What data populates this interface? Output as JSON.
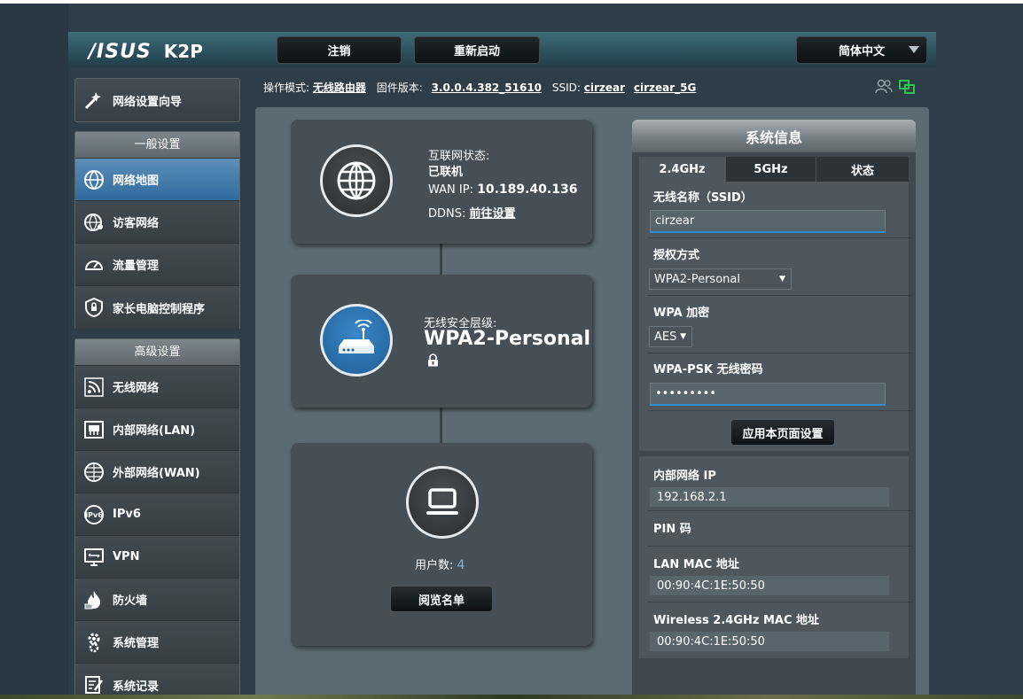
{
  "header": {
    "brand": "/ISUS",
    "model": "K2P",
    "logout_label": "注销",
    "reboot_label": "重新启动",
    "language": "简体中文"
  },
  "infobar": {
    "mode_label": "操作模式:",
    "mode_value": "无线路由器",
    "firmware_label": "固件版本:",
    "firmware_value": "3.0.0.4.382_51610",
    "ssid_label": "SSID:",
    "ssid_24": "cirzear",
    "ssid_5": "cirzear_5G"
  },
  "sidebar": {
    "quick_setup": "网络设置向导",
    "general_title": "一般设置",
    "general_items": [
      {
        "label": "网络地图",
        "icon": "network-map-icon",
        "active": true
      },
      {
        "label": "访客网络",
        "icon": "guest-network-icon",
        "active": false
      },
      {
        "label": "流量管理",
        "icon": "traffic-gauge-icon",
        "active": false
      },
      {
        "label": "家长电脑控制程序",
        "icon": "parental-lock-icon",
        "active": false
      }
    ],
    "advanced_title": "高级设置",
    "advanced_items": [
      {
        "label": "无线网络",
        "icon": "wireless-icon"
      },
      {
        "label": "内部网络(LAN)",
        "icon": "lan-icon"
      },
      {
        "label": "外部网络(WAN)",
        "icon": "wan-globe-icon"
      },
      {
        "label": "IPv6",
        "icon": "ipv6-icon"
      },
      {
        "label": "VPN",
        "icon": "vpn-icon"
      },
      {
        "label": "防火墙",
        "icon": "firewall-icon"
      },
      {
        "label": "系统管理",
        "icon": "admin-gear-icon"
      },
      {
        "label": "系统记录",
        "icon": "system-log-icon"
      }
    ]
  },
  "network_map": {
    "internet_status_label": "互联网状态:",
    "internet_status_value": "已联机",
    "wan_ip_label": "WAN IP:",
    "wan_ip_value": "10.189.40.136",
    "ddns_label": "DDNS:",
    "ddns_value": "前往设置",
    "security_label": "无线安全层级:",
    "security_value": "WPA2-Personal",
    "clients_label": "用户数:",
    "clients_count": "4",
    "view_list_button": "阅览名单"
  },
  "system_info": {
    "title": "系统信息",
    "tabs": [
      "2.4GHz",
      "5GHz",
      "状态"
    ],
    "active_tab": "2.4GHz",
    "ssid_label": "无线名称（SSID）",
    "ssid_value": "cirzear",
    "auth_label": "授权方式",
    "auth_value": "WPA2-Personal",
    "wpa_enc_label": "WPA 加密",
    "wpa_enc_value": "AES",
    "psk_label": "WPA-PSK 无线密码",
    "psk_value": "•••••••••",
    "apply_button": "应用本页面设置",
    "lan_ip_label": "内部网络 IP",
    "lan_ip_value": "192.168.2.1",
    "pin_label": "PIN 码",
    "lan_mac_label": "LAN MAC 地址",
    "lan_mac_value": "00:90:4C:1E:50:50",
    "wl_mac_label": "Wireless 2.4GHz MAC 地址",
    "wl_mac_value": "00:90:4C:1E:50:50"
  },
  "colors": {
    "accent": "#2e6a9e",
    "panel": "#454f55",
    "clients_count": "#7ab3e0"
  }
}
